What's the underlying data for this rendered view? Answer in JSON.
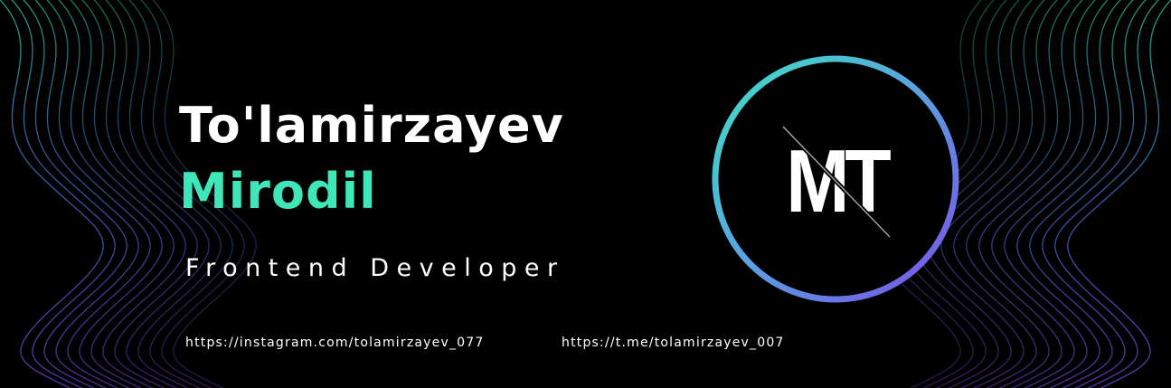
{
  "profile": {
    "surname": "To'lamirzayev",
    "given_name": "Mirodil",
    "role": "Frontend Developer"
  },
  "links": {
    "instagram": "https://instagram.com/tolamirzayev_077",
    "telegram": "https://t.me/tolamirzayev_007"
  },
  "logo": {
    "monogram": "MT"
  },
  "colors": {
    "background": "#000000",
    "accent_green": "#3fe6b8",
    "ring_teal": "#3fe0c4",
    "ring_purple": "#7a4de8",
    "wave_teal": "#2fd8a8",
    "wave_blue": "#4a78e0",
    "wave_purple": "#7a3ed8"
  }
}
